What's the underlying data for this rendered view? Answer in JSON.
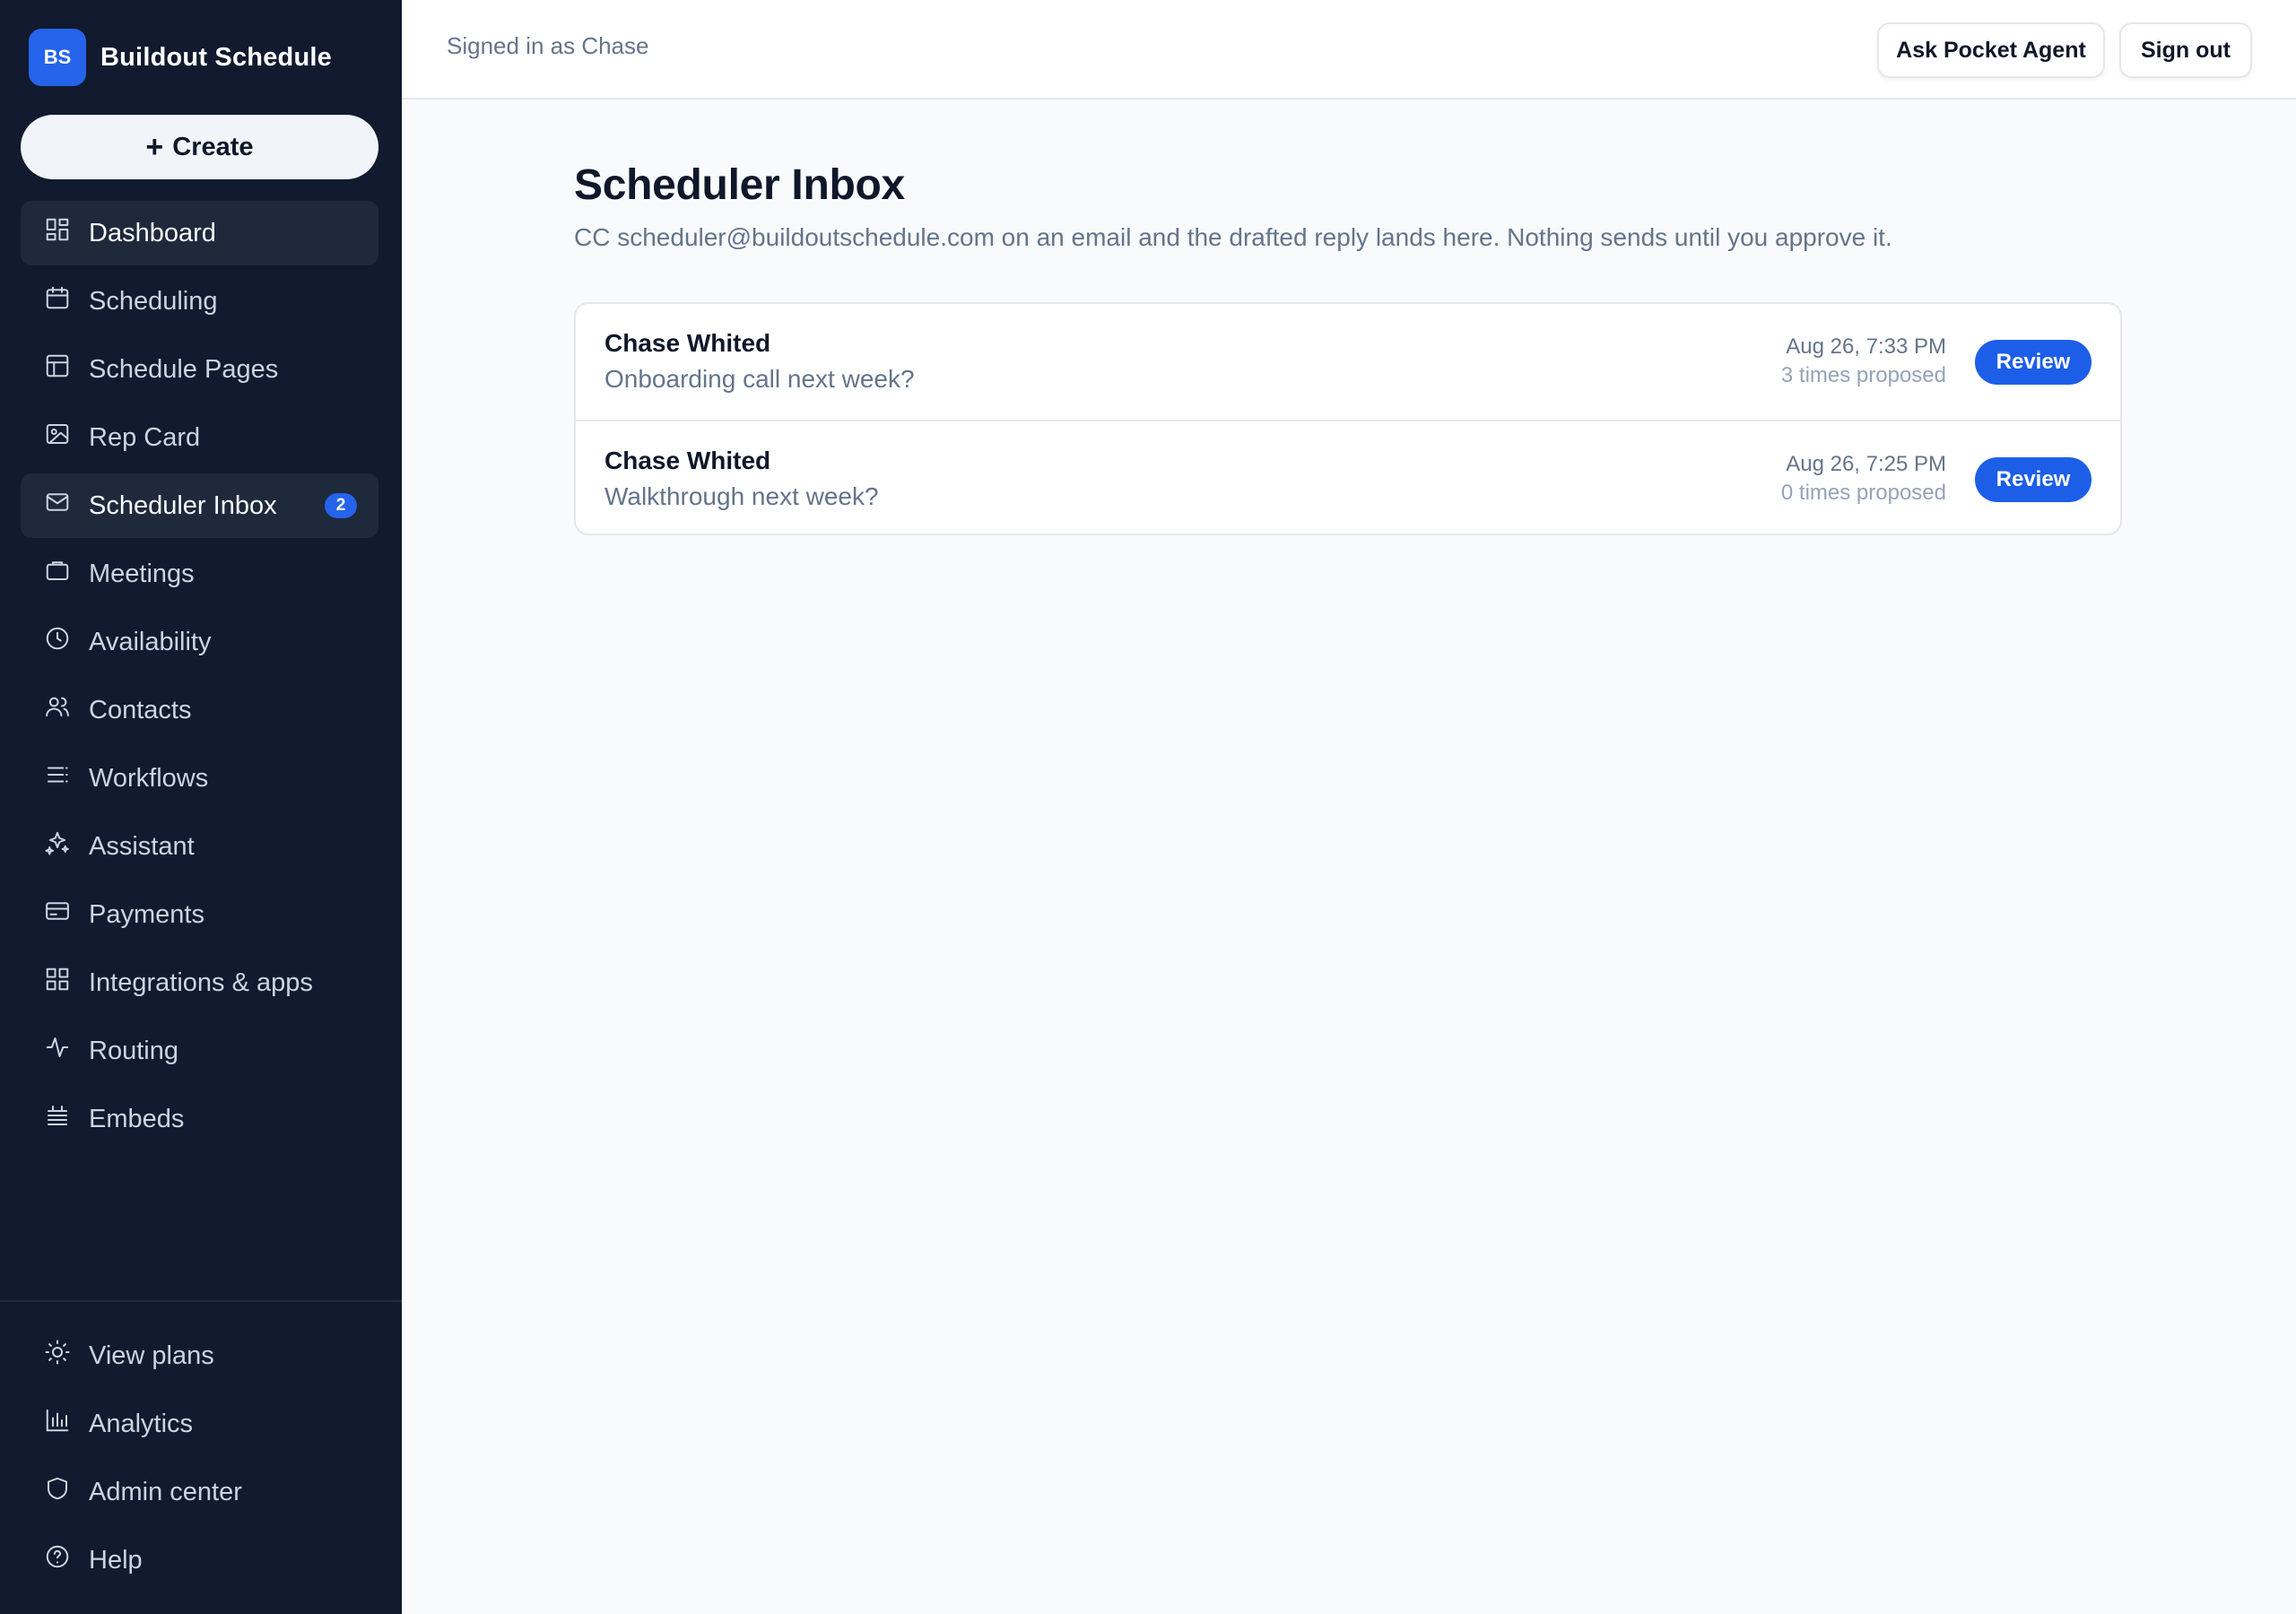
{
  "brand": {
    "logo_text": "BS",
    "name": "Buildout Schedule",
    "accent_color": "#2563eb"
  },
  "create_button": {
    "label": "Create"
  },
  "nav": {
    "items": [
      {
        "label": "Dashboard",
        "icon": "dashboard-icon",
        "active": true
      },
      {
        "label": "Scheduling",
        "icon": "calendar-icon"
      },
      {
        "label": "Schedule Pages",
        "icon": "layout-icon"
      },
      {
        "label": "Rep Card",
        "icon": "image-icon"
      },
      {
        "label": "Scheduler Inbox",
        "icon": "mail-icon",
        "active": true,
        "badge": "2"
      },
      {
        "label": "Meetings",
        "icon": "briefcase-icon"
      },
      {
        "label": "Availability",
        "icon": "clock-icon"
      },
      {
        "label": "Contacts",
        "icon": "users-icon"
      },
      {
        "label": "Workflows",
        "icon": "list-icon"
      },
      {
        "label": "Assistant",
        "icon": "sparkles-icon"
      },
      {
        "label": "Payments",
        "icon": "credit-card-icon"
      },
      {
        "label": "Integrations & apps",
        "icon": "grid-icon"
      },
      {
        "label": "Routing",
        "icon": "activity-icon"
      },
      {
        "label": "Embeds",
        "icon": "embed-icon"
      }
    ],
    "bottom_items": [
      {
        "label": "View plans",
        "icon": "sun-icon"
      },
      {
        "label": "Analytics",
        "icon": "bar-chart-icon"
      },
      {
        "label": "Admin center",
        "icon": "shield-icon"
      },
      {
        "label": "Help",
        "icon": "help-circle-icon"
      }
    ]
  },
  "topbar": {
    "signed_in_text": "Signed in as Chase",
    "ask_agent_label": "Ask Pocket Agent",
    "sign_out_label": "Sign out"
  },
  "page": {
    "title": "Scheduler Inbox",
    "subtitle": "CC scheduler@buildoutschedule.com on an email and the drafted reply lands here. Nothing sends until you approve it."
  },
  "inbox": {
    "review_label": "Review",
    "rows": [
      {
        "name": "Chase Whited",
        "subject": "Onboarding call next week?",
        "date": "Aug 26, 7:33 PM",
        "proposed": "3 times proposed"
      },
      {
        "name": "Chase Whited",
        "subject": "Walkthrough next week?",
        "date": "Aug 26, 7:25 PM",
        "proposed": "0 times proposed"
      }
    ]
  }
}
